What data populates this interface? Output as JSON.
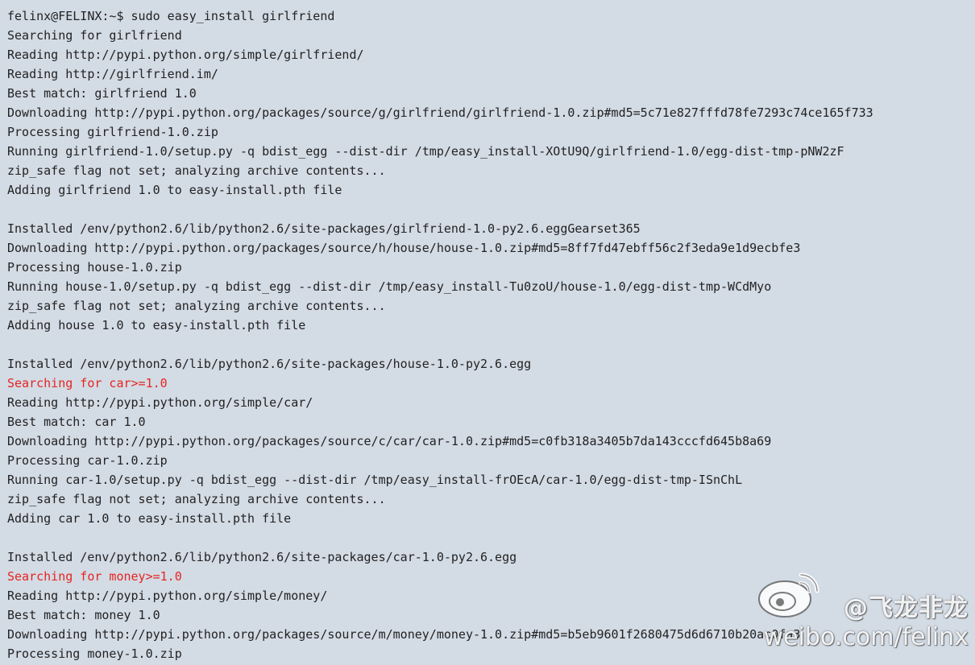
{
  "terminal": {
    "lines": [
      {
        "text": "felinx@FELINX:~$ sudo easy_install girlfriend",
        "highlight": false
      },
      {
        "text": "Searching for girlfriend",
        "highlight": false
      },
      {
        "text": "Reading http://pypi.python.org/simple/girlfriend/",
        "highlight": false
      },
      {
        "text": "Reading http://girlfriend.im/",
        "highlight": false
      },
      {
        "text": "Best match: girlfriend 1.0",
        "highlight": false
      },
      {
        "text": "Downloading http://pypi.python.org/packages/source/g/girlfriend/girlfriend-1.0.zip#md5=5c71e827fffd78fe7293c74ce165f733",
        "highlight": false
      },
      {
        "text": "Processing girlfriend-1.0.zip",
        "highlight": false
      },
      {
        "text": "Running girlfriend-1.0/setup.py -q bdist_egg --dist-dir /tmp/easy_install-XOtU9Q/girlfriend-1.0/egg-dist-tmp-pNW2zF",
        "highlight": false
      },
      {
        "text": "zip_safe flag not set; analyzing archive contents...",
        "highlight": false
      },
      {
        "text": "Adding girlfriend 1.0 to easy-install.pth file",
        "highlight": false
      },
      {
        "text": "",
        "highlight": false
      },
      {
        "text": "Installed /env/python2.6/lib/python2.6/site-packages/girlfriend-1.0-py2.6.eggGearset365",
        "highlight": false
      },
      {
        "text": "Downloading http://pypi.python.org/packages/source/h/house/house-1.0.zip#md5=8ff7fd47ebff56c2f3eda9e1d9ecbfe3",
        "highlight": false
      },
      {
        "text": "Processing house-1.0.zip",
        "highlight": false
      },
      {
        "text": "Running house-1.0/setup.py -q bdist_egg --dist-dir /tmp/easy_install-Tu0zoU/house-1.0/egg-dist-tmp-WCdMyo",
        "highlight": false
      },
      {
        "text": "zip_safe flag not set; analyzing archive contents...",
        "highlight": false
      },
      {
        "text": "Adding house 1.0 to easy-install.pth file",
        "highlight": false
      },
      {
        "text": "",
        "highlight": false
      },
      {
        "text": "Installed /env/python2.6/lib/python2.6/site-packages/house-1.0-py2.6.egg",
        "highlight": false
      },
      {
        "text": "Searching for car>=1.0",
        "highlight": true
      },
      {
        "text": "Reading http://pypi.python.org/simple/car/",
        "highlight": false
      },
      {
        "text": "Best match: car 1.0",
        "highlight": false
      },
      {
        "text": "Downloading http://pypi.python.org/packages/source/c/car/car-1.0.zip#md5=c0fb318a3405b7da143cccfd645b8a69",
        "highlight": false
      },
      {
        "text": "Processing car-1.0.zip",
        "highlight": false
      },
      {
        "text": "Running car-1.0/setup.py -q bdist_egg --dist-dir /tmp/easy_install-frOEcA/car-1.0/egg-dist-tmp-ISnChL",
        "highlight": false
      },
      {
        "text": "zip_safe flag not set; analyzing archive contents...",
        "highlight": false
      },
      {
        "text": "Adding car 1.0 to easy-install.pth file",
        "highlight": false
      },
      {
        "text": "",
        "highlight": false
      },
      {
        "text": "Installed /env/python2.6/lib/python2.6/site-packages/car-1.0-py2.6.egg",
        "highlight": false
      },
      {
        "text": "Searching for money>=1.0",
        "highlight": true
      },
      {
        "text": "Reading http://pypi.python.org/simple/money/",
        "highlight": false
      },
      {
        "text": "Best match: money 1.0",
        "highlight": false
      },
      {
        "text": "Downloading http://pypi.python.org/packages/source/m/money/money-1.0.zip#md5=b5eb9601f2680475d6d6710b20ac0fa3",
        "highlight": false
      },
      {
        "text": "Processing money-1.0.zip",
        "highlight": false
      }
    ]
  },
  "watermark": {
    "handle": "@飞龙非龙",
    "url": "weibo.com/felinx",
    "logo_icon": "weibo-logo-icon"
  },
  "colors": {
    "background": "#d3dbe5",
    "text": "#222222",
    "highlight": "#e52520"
  }
}
